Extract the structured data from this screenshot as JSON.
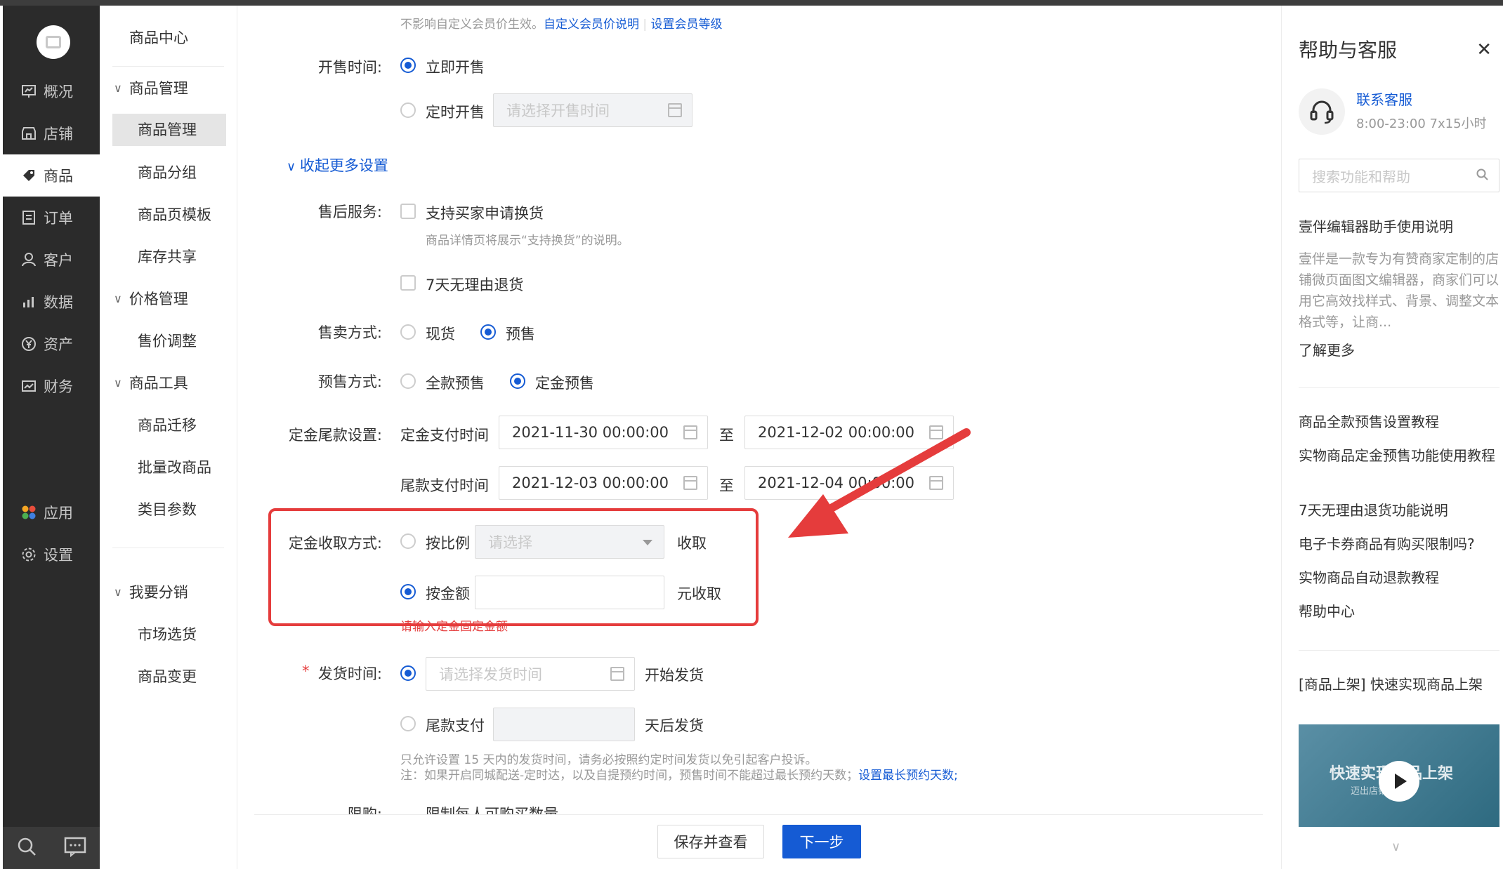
{
  "nav": {
    "items": [
      {
        "label": "概况",
        "icon": "dashboard-icon"
      },
      {
        "label": "店铺",
        "icon": "store-icon"
      },
      {
        "label": "商品",
        "icon": "tag-icon"
      },
      {
        "label": "订单",
        "icon": "order-icon"
      },
      {
        "label": "客户",
        "icon": "user-icon"
      },
      {
        "label": "数据",
        "icon": "chart-icon"
      },
      {
        "label": "资产",
        "icon": "yen-icon"
      },
      {
        "label": "财务",
        "icon": "finance-icon"
      },
      {
        "label": "应用",
        "icon": "apps-icon"
      },
      {
        "label": "设置",
        "icon": "gear-icon"
      }
    ],
    "active": "商品"
  },
  "submenu": {
    "title": "商品中心",
    "groups": [
      {
        "label": "商品管理",
        "items": [
          "商品管理",
          "商品分组",
          "商品页模板",
          "库存共享"
        ]
      },
      {
        "label": "价格管理",
        "items": [
          "售价调整"
        ]
      },
      {
        "label": "商品工具",
        "items": [
          "商品迁移",
          "批量改商品",
          "类目参数"
        ]
      },
      {
        "label": "我要分销",
        "items": [
          "市场选货",
          "商品变更"
        ]
      }
    ],
    "active": "商品管理"
  },
  "form": {
    "top_hint": "不影响自定义会员价生效。",
    "top_link1": "自定义会员价说明",
    "top_link2": "设置会员等级",
    "sale_time": {
      "label": "开售时间:",
      "opt_now": "立即开售",
      "opt_timed": "定时开售",
      "timed_placeholder": "请选择开售时间"
    },
    "collapse_more": "收起更多设置",
    "after_sale": {
      "label": "售后服务:",
      "exchange": "支持买家申请换货",
      "exchange_hint": "商品详情页将展示“支持换货”的说明。",
      "return7": "7天无理由退货"
    },
    "sale_mode": {
      "label": "售卖方式:",
      "spot": "现货",
      "presale": "预售"
    },
    "presale_mode": {
      "label": "预售方式:",
      "full": "全款预售",
      "deposit": "定金预售"
    },
    "deposit_setting": {
      "label": "定金尾款设置:",
      "deposit_pay_time": "定金支付时间",
      "deposit_start": "2021-11-30 00:00:00",
      "deposit_end": "2021-12-02 00:00:00",
      "final_pay_time": "尾款支付时间",
      "final_start": "2021-12-03 00:00:00",
      "final_end": "2021-12-04 00:00:00",
      "to": "至"
    },
    "deposit_collect": {
      "label": "定金收取方式:",
      "by_ratio": "按比例",
      "ratio_placeholder": "请选择",
      "collect": "收取",
      "by_amount": "按金额",
      "amount_value": "",
      "yuan_collect": "元收取",
      "error": "请输入定金固定金额"
    },
    "ship_time": {
      "required_mark": "*",
      "label": "发货时间:",
      "placeholder": "请选择发货时间",
      "start_ship": "开始发货",
      "final_pay": "尾款支付",
      "days_after": "天后发货",
      "hint1": "只允许设置 15 天内的发货时间，请务必按照约定时间发货以免引起客户投诉。",
      "hint2": "注：如果开启同城配送-定时达，以及自提预约时间，预售时间不能超过最长预约天数；",
      "hint2_link": "设置最长预约天数;"
    },
    "limit": {
      "label": "限购:",
      "per_person": "限制每人可购买数量"
    }
  },
  "footer": {
    "save_view": "保存并查看",
    "next": "下一步"
  },
  "help": {
    "title": "帮助与客服",
    "contact": "联系客服",
    "hours": "8:00-23:00  7x15小时",
    "search_placeholder": "搜索功能和帮助",
    "article_title": "壹伴编辑器助手使用说明",
    "article_desc": "壹伴是一款专为有赞商家定制的店铺微页面图文编辑器，商家们可以用它高效找样式、背景、调整文本格式等，让商...",
    "learn_more": "了解更多",
    "links": [
      "商品全款预售设置教程",
      "实物商品定金预售功能使用教程",
      "7天无理由退货功能说明",
      "电子卡券商品有购买限制吗?",
      "实物商品自动退款教程"
    ],
    "help_center": "帮助中心",
    "video_caption": "[商品上架]  快速实现商品上架",
    "video_title": "快速实现商品上架",
    "video_sub": "迈出店铺第一步"
  },
  "colors": {
    "accent": "#155bd4",
    "danger": "#e53c3c",
    "sidebar": "#2b2b2b"
  }
}
